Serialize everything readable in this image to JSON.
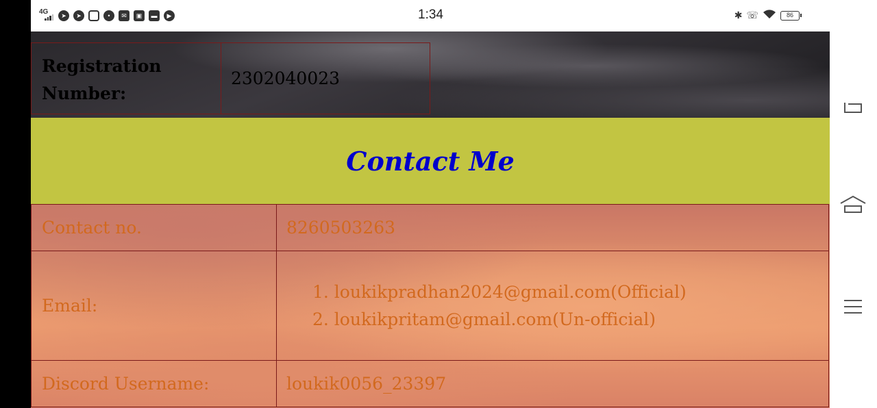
{
  "status_bar": {
    "network": "4G",
    "time": "1:34",
    "battery": "86",
    "app_icons": [
      "telegram-icon",
      "telegram-icon",
      "instagram-icon",
      "messages-icon",
      "gmail-icon",
      "app-icon",
      "paytm-icon",
      "youtube-icon"
    ]
  },
  "registration": {
    "label": "Registration Number:",
    "value": "2302040023"
  },
  "contact": {
    "title": "Contact Me",
    "rows": {
      "contact_no": {
        "label": "Contact no.",
        "value": "8260503263"
      },
      "email": {
        "label": "Email:",
        "items": [
          "1. loukikpradhan2024@gmail.com(Official)",
          "2. loukikpritam@gmail.com(Un-official)"
        ]
      },
      "discord": {
        "label": "Discord Username:",
        "value": "loukik0056_23397"
      }
    }
  },
  "colors": {
    "contact_header_bg": "#c2c542",
    "contact_title": "#0000cc",
    "contact_text": "#d2691e",
    "table_border": "#7a1a1a"
  }
}
